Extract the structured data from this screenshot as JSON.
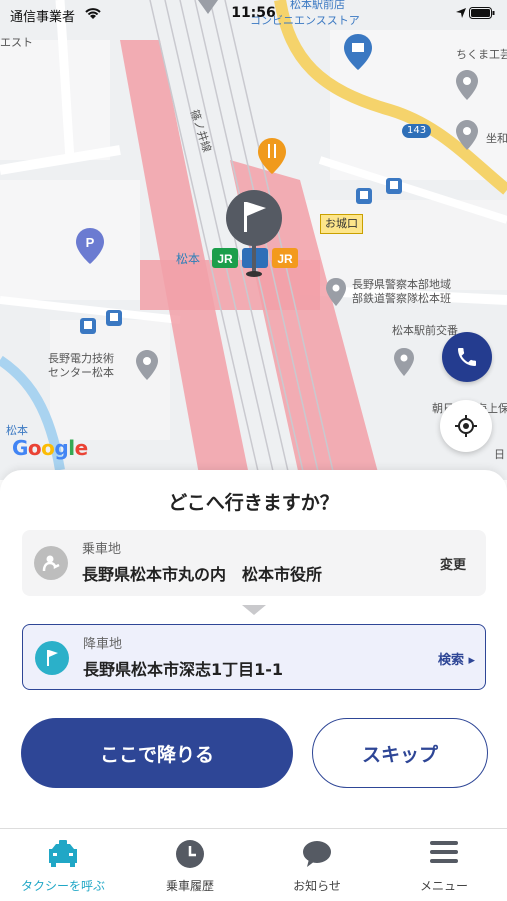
{
  "status_bar": {
    "carrier": "通信事業者",
    "time": "11:56"
  },
  "map": {
    "labels": {
      "station_north": "松本駅前店",
      "convenience": "コンビニエンスストア",
      "ekisuto": "エスト",
      "chikuma": "ちくま工芸",
      "tsubo": "坐和",
      "route": "143",
      "line_name": "篠ノ井線",
      "oshiroguchi": "お城口",
      "matsumoto": "松本",
      "police": "長野県警察本部地域\n部鉄道警察隊松本班",
      "crossing": "松本駅前交番",
      "power": "長野電力技術\nセンター松本",
      "asahi": "朝日火災海上保険",
      "matsumoto_left": "松本",
      "hi": "日"
    },
    "google": "Google"
  },
  "sheet": {
    "title": "どこへ行きますか？",
    "pickup": {
      "type": "乗車地",
      "address": "長野県松本市丸の内　松本市役所",
      "action": "変更"
    },
    "dropoff": {
      "type": "降車地",
      "address": "長野県松本市深志1丁目1-1",
      "action": "検索 ▸"
    },
    "primary_button": "ここで降りる",
    "skip_button": "スキップ"
  },
  "tabs": [
    {
      "label": "タクシーを呼ぶ",
      "icon": "taxi-icon",
      "active": true
    },
    {
      "label": "乗車履歴",
      "icon": "clock-icon",
      "active": false
    },
    {
      "label": "お知らせ",
      "icon": "chat-bubble-icon",
      "active": false
    },
    {
      "label": "メニュー",
      "icon": "menu-icon",
      "active": false
    }
  ],
  "colors": {
    "primary": "#2e4696",
    "active_tab": "#20a7c6",
    "rail": "#f2a0a8",
    "road_yellow": "#f5d36b"
  }
}
